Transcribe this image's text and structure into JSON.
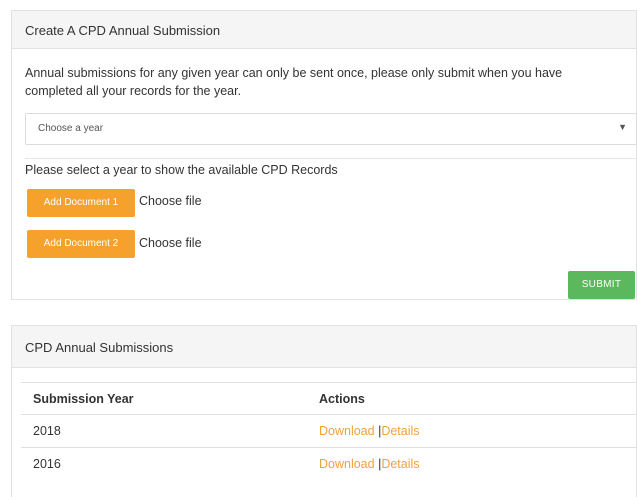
{
  "create_panel": {
    "title": "Create A CPD Annual Submission",
    "intro_line1": "Annual submissions for any given year can only be sent once, please only submit when you have",
    "intro_line2": "completed all your records for the year.",
    "year_select": {
      "value": "Choose a year"
    },
    "hint": "Please select a year to show the available CPD Records",
    "doc1_label": "Add Document 1",
    "doc2_label": "Add Document 2",
    "choose_file": "Choose file",
    "submit_label": "SUBMIT",
    "colors": {
      "orange": "#f5a12c",
      "green": "#5cb85c"
    }
  },
  "submissions_panel": {
    "title": "CPD Annual Submissions",
    "columns": [
      "Submission Year",
      "Actions"
    ],
    "rows": [
      {
        "year": "2018",
        "download": "Download",
        "separator": "|",
        "details": "Details"
      },
      {
        "year": "2016",
        "download": "Download",
        "separator": "|",
        "details": "Details"
      }
    ],
    "colors": {
      "link": "#f0a23a"
    }
  }
}
